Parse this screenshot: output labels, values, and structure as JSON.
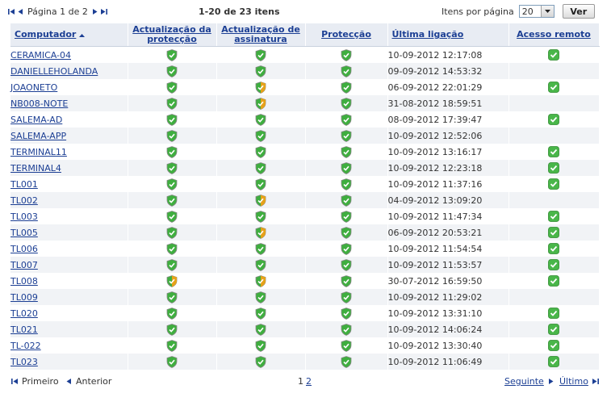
{
  "pager": {
    "page_text": "Página 1 de 2",
    "range_text": "1-20 de 23 itens",
    "per_page_label": "Itens por página",
    "per_page_value": "20",
    "go_button": "Ver"
  },
  "columns": {
    "computer": "Computador",
    "protection_update": [
      "Actualização da",
      "protecção"
    ],
    "signature_update": [
      "Actualização de",
      "assinatura"
    ],
    "protection": "Protecção",
    "last_connection": "Última ligação",
    "remote_access": "Acesso remoto"
  },
  "status_colors": {
    "ok": "#3fae3f",
    "warning": "#e6a21a",
    "remote": "#49b649"
  },
  "rows": [
    {
      "computer": "CERAMICA-04",
      "prot_update": "ok",
      "sig_update": "ok",
      "protection": "ok",
      "last_connection": "10-09-2012 12:17:08",
      "remote": true
    },
    {
      "computer": "DANIELLEHOLANDA",
      "prot_update": "ok",
      "sig_update": "ok",
      "protection": "ok",
      "last_connection": "09-09-2012 14:53:32",
      "remote": false
    },
    {
      "computer": "JOAONETO",
      "prot_update": "ok",
      "sig_update": "warning",
      "protection": "ok",
      "last_connection": "06-09-2012 22:01:29",
      "remote": true
    },
    {
      "computer": "NB008-NOTE",
      "prot_update": "ok",
      "sig_update": "warning",
      "protection": "ok",
      "last_connection": "31-08-2012 18:59:51",
      "remote": false
    },
    {
      "computer": "SALEMA-AD",
      "prot_update": "ok",
      "sig_update": "ok",
      "protection": "ok",
      "last_connection": "08-09-2012 17:39:47",
      "remote": true
    },
    {
      "computer": "SALEMA-APP",
      "prot_update": "ok",
      "sig_update": "ok",
      "protection": "ok",
      "last_connection": "10-09-2012 12:52:06",
      "remote": false
    },
    {
      "computer": "TERMINAL11",
      "prot_update": "ok",
      "sig_update": "ok",
      "protection": "ok",
      "last_connection": "10-09-2012 13:16:17",
      "remote": true
    },
    {
      "computer": "TERMINAL4",
      "prot_update": "ok",
      "sig_update": "ok",
      "protection": "ok",
      "last_connection": "10-09-2012 12:23:18",
      "remote": true
    },
    {
      "computer": "TL001",
      "prot_update": "ok",
      "sig_update": "ok",
      "protection": "ok",
      "last_connection": "10-09-2012 11:37:16",
      "remote": true
    },
    {
      "computer": "TL002",
      "prot_update": "ok",
      "sig_update": "warning",
      "protection": "ok",
      "last_connection": "04-09-2012 13:09:20",
      "remote": false
    },
    {
      "computer": "TL003",
      "prot_update": "ok",
      "sig_update": "ok",
      "protection": "ok",
      "last_connection": "10-09-2012 11:47:34",
      "remote": true
    },
    {
      "computer": "TL005",
      "prot_update": "ok",
      "sig_update": "warning",
      "protection": "ok",
      "last_connection": "06-09-2012 20:53:21",
      "remote": true
    },
    {
      "computer": "TL006",
      "prot_update": "ok",
      "sig_update": "ok",
      "protection": "ok",
      "last_connection": "10-09-2012 11:54:54",
      "remote": true
    },
    {
      "computer": "TL007",
      "prot_update": "ok",
      "sig_update": "ok",
      "protection": "ok",
      "last_connection": "10-09-2012 11:53:57",
      "remote": true
    },
    {
      "computer": "TL008",
      "prot_update": "warning",
      "sig_update": "warning",
      "protection": "ok",
      "last_connection": "30-07-2012 16:59:50",
      "remote": true
    },
    {
      "computer": "TL009",
      "prot_update": "ok",
      "sig_update": "ok",
      "protection": "ok",
      "last_connection": "10-09-2012 11:29:02",
      "remote": false
    },
    {
      "computer": "TL020",
      "prot_update": "ok",
      "sig_update": "ok",
      "protection": "ok",
      "last_connection": "10-09-2012 13:31:10",
      "remote": true
    },
    {
      "computer": "TL021",
      "prot_update": "ok",
      "sig_update": "ok",
      "protection": "ok",
      "last_connection": "10-09-2012 14:06:24",
      "remote": true
    },
    {
      "computer": "TL-022",
      "prot_update": "ok",
      "sig_update": "ok",
      "protection": "ok",
      "last_connection": "10-09-2012 13:30:40",
      "remote": true
    },
    {
      "computer": "TL023",
      "prot_update": "ok",
      "sig_update": "ok",
      "protection": "ok",
      "last_connection": "10-09-2012 11:06:49",
      "remote": true
    }
  ],
  "footer": {
    "first": "Primeiro",
    "previous": "Anterior",
    "current_page": "1",
    "other_page": "2",
    "next": "Seguinte",
    "last": "Último"
  }
}
